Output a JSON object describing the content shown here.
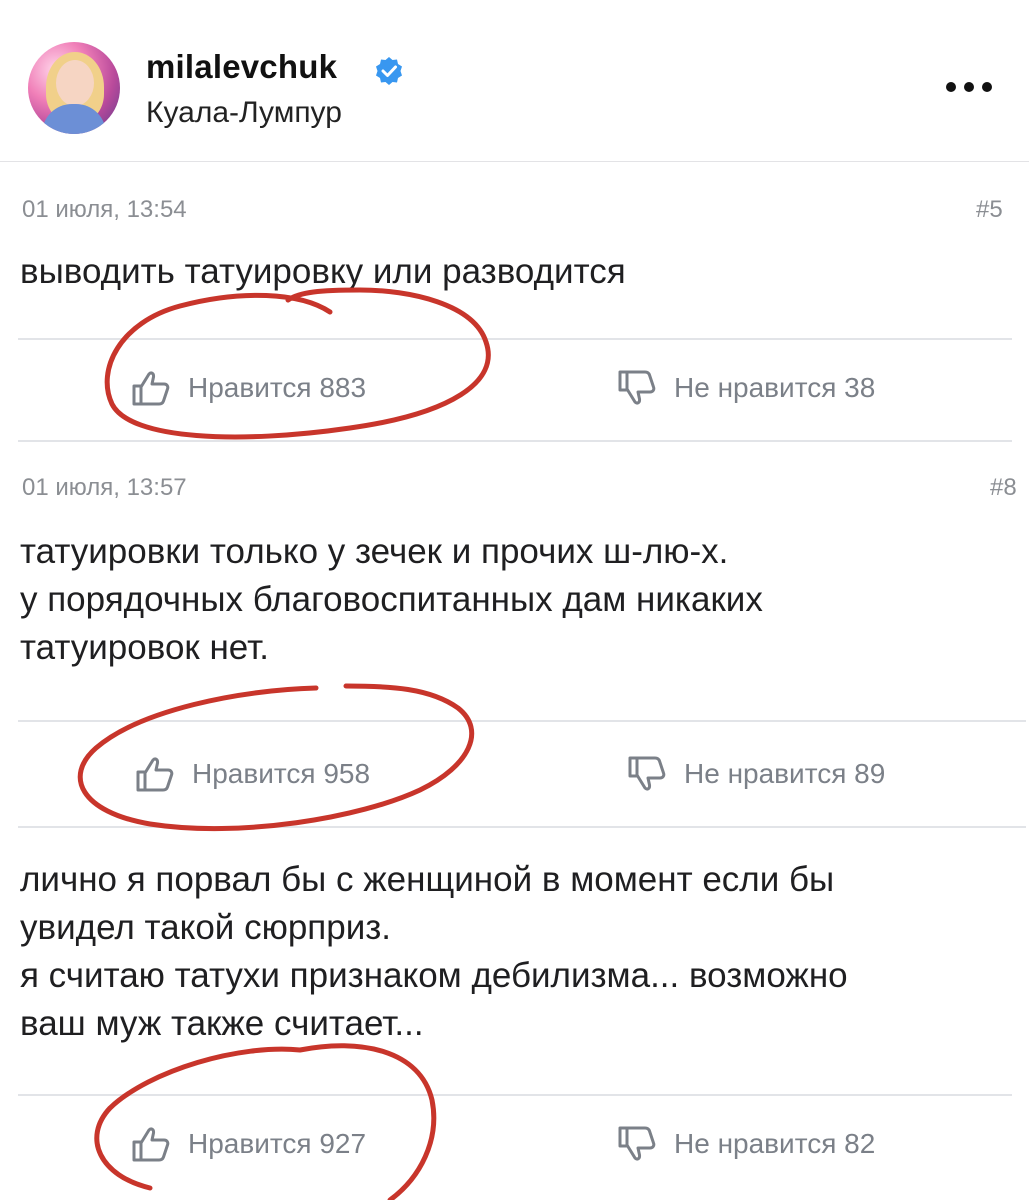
{
  "header": {
    "username": "milalevchuk",
    "location": "Куала-Лумпур"
  },
  "comments": [
    {
      "date": "01 июля, 13:54",
      "number": "#5",
      "lines": [
        "выводить татуировку или разводится"
      ],
      "like_label": "Нравится 883",
      "dislike_label": "Не нравится 38"
    },
    {
      "date": "01 июля, 13:57",
      "number": "#8",
      "lines": [
        "татуировки только у зечек и прочих ш-лю-х.",
        "у порядочных благовоспитанных дам никаких",
        "татуировок нет."
      ],
      "like_label": "Нравится 958",
      "dislike_label": "Не нравится 89"
    },
    {
      "lines": [
        "лично я порвал бы с женщиной в момент если бы",
        "увидел такой сюрприз.",
        "я считаю татухи признаком дебилизма... возможно",
        "ваш муж также считает..."
      ],
      "like_label": "Нравится 927",
      "dislike_label": "Не нравится 82"
    }
  ],
  "colors": {
    "annotation_red": "#c8352b",
    "verified_blue": "#3897f0",
    "muted_text": "#8b8e93"
  }
}
